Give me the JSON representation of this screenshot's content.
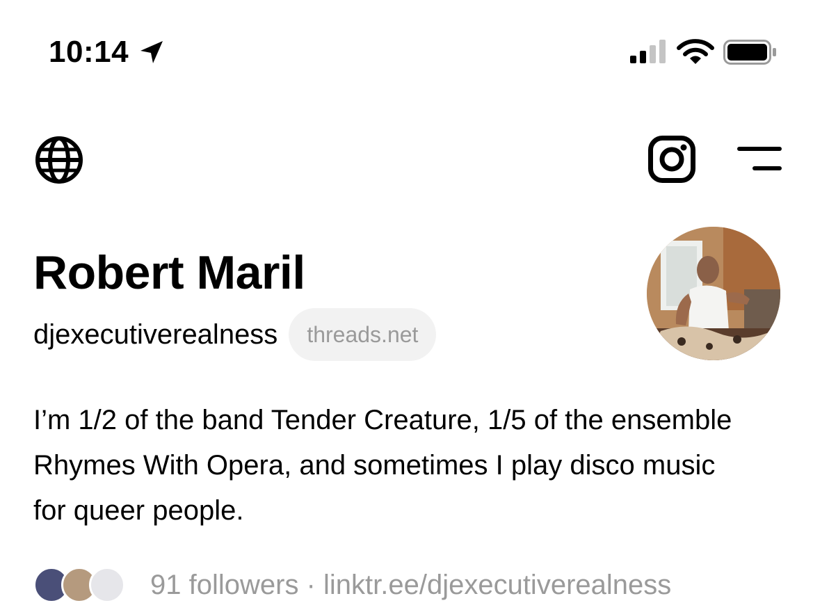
{
  "status_bar": {
    "time": "10:14",
    "icons": [
      "location-arrow-icon",
      "cellular-signal-icon",
      "wifi-icon",
      "battery-icon"
    ]
  },
  "nav": {
    "icons": [
      "globe-icon",
      "instagram-icon",
      "menu-icon"
    ]
  },
  "profile": {
    "name": "Robert Maril",
    "handle": "djexecutiverealness",
    "domain": "threads.net",
    "bio": "I’m 1/2 of the band Tender Creature, 1/5 of the ensemble Rhymes With Opera, and sometimes I play disco music for queer people.",
    "followers_text": "91 followers · linktr.ee/djexecutiverealness"
  },
  "colors": {
    "text": "#000000",
    "muted": "#9a9a9a",
    "pill_bg": "#f2f2f2"
  }
}
